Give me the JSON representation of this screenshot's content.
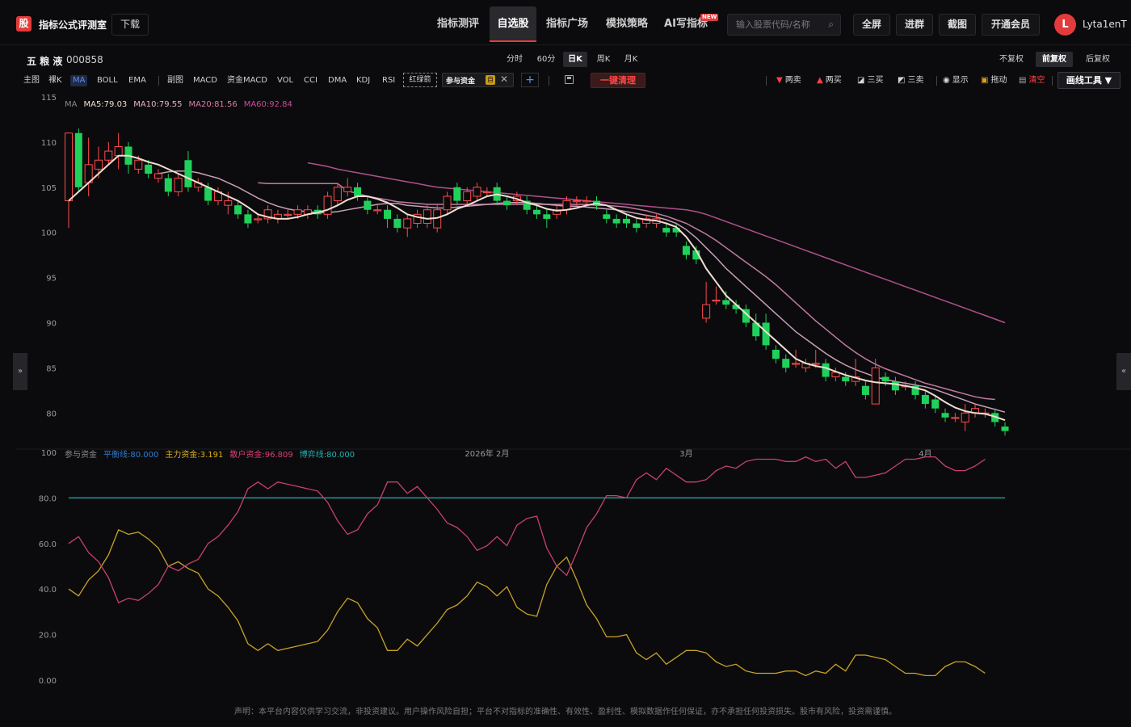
{
  "topbar": {
    "logo_glyph": "股",
    "brand": "指标公式评测室",
    "download": "下载",
    "nav": [
      "指标测评",
      "自选股",
      "指标广场",
      "模拟策略",
      "AI写指标"
    ],
    "active_nav": 1,
    "new_badge": "NEW",
    "search_placeholder": "输入股票代码/名称",
    "buttons": [
      "全屏",
      "进群",
      "截图",
      "开通会员"
    ],
    "avatar_letter": "L",
    "username": "Lyta1enT"
  },
  "stock": {
    "name": "五 粮 液",
    "code": "000858"
  },
  "periods": [
    "分时",
    "60分",
    "日K",
    "周K",
    "月K"
  ],
  "active_period": 2,
  "adjusts": [
    "不复权",
    "前复权",
    "后复权"
  ],
  "active_adjust": 1,
  "indicators_main": [
    "主图",
    "裸K",
    "MA",
    "BOLL",
    "EMA"
  ],
  "indicators_sub": [
    "副图",
    "MACD",
    "资金MACD",
    "VOL",
    "CCI",
    "DMA",
    "KDJ",
    "RSI"
  ],
  "hongluejian": "红绿箭",
  "cyzj_tag": {
    "label": "参与资金",
    "self": "自"
  },
  "clear_button": "一键清理",
  "draw_items": [
    {
      "glyph": "▼",
      "color": "#ff4040",
      "label": "两卖"
    },
    {
      "glyph": "▲",
      "color": "#ff4040",
      "label": "两买"
    },
    {
      "glyph": "◪",
      "color": "#dddddd",
      "label": "三买"
    },
    {
      "glyph": "◩",
      "color": "#dddddd",
      "label": "三卖"
    },
    {
      "glyph": "◉",
      "color": "#dddddd",
      "label": "显示"
    },
    {
      "glyph": "🔒",
      "color": "#e0a020",
      "label": "拖动"
    },
    {
      "glyph": "🗑",
      "color": "#aaaaaa",
      "label": "清空",
      "label_color": "#ff4040"
    }
  ],
  "draw_tools": "画线工具 ▼",
  "disclaimer": "声明：本平台内容仅供学习交流，非投资建议。用户操作风险自担；平台不对指标的准确性、有效性、盈利性、模拟数据作任何保证，亦不承担任何投资损失。股市有风险，投资需谨慎。",
  "colors": {
    "up": "#ff4b4b",
    "down": "#1fd15a",
    "ma5": "#f0ddd0",
    "ma10": "#c7a0b6",
    "ma20": "#c17aa0",
    "ma60": "#b0508e",
    "balance": "#1fb3b3",
    "main": "#c9a227",
    "retail": "#c8416a"
  },
  "chart_data": {
    "type": "candlestick",
    "ma_legend": {
      "title": "MA",
      "items": [
        "MA5:79.03",
        "MA10:79.55",
        "MA20:81.56",
        "MA60:92.84"
      ]
    },
    "price_ylim": [
      76,
      115
    ],
    "price_ticks": [
      80,
      85,
      90,
      95,
      100,
      105,
      110,
      115
    ],
    "x_labels": [
      {
        "i": 42,
        "label": "2026年  2月"
      },
      {
        "i": 62,
        "label": "3月"
      },
      {
        "i": 86,
        "label": "4月"
      }
    ],
    "candles": [
      {
        "o": 103.5,
        "c": 111,
        "h": 111,
        "l": 100.5
      },
      {
        "o": 111,
        "c": 105,
        "h": 111.5,
        "l": 104.5
      },
      {
        "o": 105.5,
        "c": 107.5,
        "h": 110.5,
        "l": 104
      },
      {
        "o": 107,
        "c": 108,
        "h": 109.5,
        "l": 106
      },
      {
        "o": 108,
        "c": 109,
        "h": 110,
        "l": 107.5
      },
      {
        "o": 108.5,
        "c": 109.5,
        "h": 111,
        "l": 107
      },
      {
        "o": 109.5,
        "c": 107.5,
        "h": 110,
        "l": 106.5
      },
      {
        "o": 107,
        "c": 108,
        "h": 108.5,
        "l": 106.5
      },
      {
        "o": 107.5,
        "c": 106.5,
        "h": 108,
        "l": 106
      },
      {
        "o": 106,
        "c": 106.5,
        "h": 107,
        "l": 105.5
      },
      {
        "o": 106,
        "c": 104.5,
        "h": 106.5,
        "l": 104
      },
      {
        "o": 104.5,
        "c": 106,
        "h": 106.5,
        "l": 104
      },
      {
        "o": 108,
        "c": 105,
        "h": 109,
        "l": 104.5
      },
      {
        "o": 105,
        "c": 105.5,
        "h": 106,
        "l": 104.5
      },
      {
        "o": 105,
        "c": 103.5,
        "h": 105.5,
        "l": 103
      },
      {
        "o": 103.5,
        "c": 104.5,
        "h": 105,
        "l": 103
      },
      {
        "o": 103,
        "c": 103.5,
        "h": 104.5,
        "l": 102
      },
      {
        "o": 103,
        "c": 102,
        "h": 103.5,
        "l": 101.5
      },
      {
        "o": 102,
        "c": 101,
        "h": 102.5,
        "l": 100.5
      },
      {
        "o": 101.5,
        "c": 101.5,
        "h": 102,
        "l": 101
      },
      {
        "o": 101.5,
        "c": 102.5,
        "h": 103,
        "l": 101
      },
      {
        "o": 101.5,
        "c": 102,
        "h": 102.5,
        "l": 101
      },
      {
        "o": 102,
        "c": 102,
        "h": 102.5,
        "l": 101.5
      },
      {
        "o": 102,
        "c": 102.5,
        "h": 103,
        "l": 101.5
      },
      {
        "o": 102,
        "c": 102.5,
        "h": 103,
        "l": 101.5
      },
      {
        "o": 102.5,
        "c": 102,
        "h": 103,
        "l": 101.5
      },
      {
        "o": 102,
        "c": 104,
        "h": 104.5,
        "l": 101.5
      },
      {
        "o": 103.5,
        "c": 105,
        "h": 105.5,
        "l": 103
      },
      {
        "o": 104.5,
        "c": 105,
        "h": 106,
        "l": 104
      },
      {
        "o": 105,
        "c": 104,
        "h": 105.5,
        "l": 103.5
      },
      {
        "o": 103.5,
        "c": 102.5,
        "h": 104,
        "l": 102
      },
      {
        "o": 102.5,
        "c": 102.5,
        "h": 103,
        "l": 102
      },
      {
        "o": 102.5,
        "c": 101.5,
        "h": 103,
        "l": 100.5
      },
      {
        "o": 101.5,
        "c": 100.5,
        "h": 102,
        "l": 100
      },
      {
        "o": 100.5,
        "c": 101.5,
        "h": 102,
        "l": 99.5
      },
      {
        "o": 101,
        "c": 102,
        "h": 102.5,
        "l": 100.5
      },
      {
        "o": 101,
        "c": 102.5,
        "h": 103,
        "l": 100.5
      },
      {
        "o": 100.5,
        "c": 102.5,
        "h": 103,
        "l": 100
      },
      {
        "o": 102.5,
        "c": 104,
        "h": 104.5,
        "l": 102
      },
      {
        "o": 105,
        "c": 103.5,
        "h": 105.5,
        "l": 103
      },
      {
        "o": 103.5,
        "c": 104.5,
        "h": 105,
        "l": 103
      },
      {
        "o": 104,
        "c": 105,
        "h": 105.5,
        "l": 103.5
      },
      {
        "o": 104.5,
        "c": 104.5,
        "h": 105,
        "l": 104
      },
      {
        "o": 105,
        "c": 103.5,
        "h": 105.5,
        "l": 103
      },
      {
        "o": 103.5,
        "c": 103,
        "h": 104,
        "l": 102.5
      },
      {
        "o": 103.5,
        "c": 104,
        "h": 104.5,
        "l": 103
      },
      {
        "o": 103.5,
        "c": 102.5,
        "h": 104,
        "l": 102
      },
      {
        "o": 102.5,
        "c": 102,
        "h": 103,
        "l": 101.5
      },
      {
        "o": 102,
        "c": 101.5,
        "h": 102.5,
        "l": 100.5
      },
      {
        "o": 102,
        "c": 102.5,
        "h": 103,
        "l": 101.5
      },
      {
        "o": 102.5,
        "c": 103.5,
        "h": 104,
        "l": 102
      },
      {
        "o": 103.5,
        "c": 103.5,
        "h": 104,
        "l": 103
      },
      {
        "o": 103.5,
        "c": 103.5,
        "h": 104,
        "l": 103
      },
      {
        "o": 103.5,
        "c": 103,
        "h": 104,
        "l": 102.5
      },
      {
        "o": 102,
        "c": 101.5,
        "h": 102.5,
        "l": 101
      },
      {
        "o": 101.5,
        "c": 101,
        "h": 102,
        "l": 100.5
      },
      {
        "o": 101.5,
        "c": 101,
        "h": 102,
        "l": 100.5
      },
      {
        "o": 101,
        "c": 100.5,
        "h": 101.5,
        "l": 100
      },
      {
        "o": 101,
        "c": 101.5,
        "h": 102,
        "l": 100.5
      },
      {
        "o": 101,
        "c": 101.5,
        "h": 102,
        "l": 100.5
      },
      {
        "o": 100.5,
        "c": 100,
        "h": 101,
        "l": 99.5
      },
      {
        "o": 100.5,
        "c": 100,
        "h": 101,
        "l": 99.5
      },
      {
        "o": 98.5,
        "c": 97.5,
        "h": 99,
        "l": 97
      },
      {
        "o": 98,
        "c": 97,
        "h": 98.5,
        "l": 96.5
      },
      {
        "o": 90.5,
        "c": 92,
        "h": 94.5,
        "l": 90
      },
      {
        "o": 92.5,
        "c": 92.5,
        "h": 94,
        "l": 92
      },
      {
        "o": 92.5,
        "c": 92,
        "h": 93.5,
        "l": 91.5
      },
      {
        "o": 92,
        "c": 91.5,
        "h": 92.5,
        "l": 91
      },
      {
        "o": 91.5,
        "c": 90,
        "h": 92,
        "l": 89.5
      },
      {
        "o": 90,
        "c": 88.5,
        "h": 91,
        "l": 88
      },
      {
        "o": 90,
        "c": 87.5,
        "h": 91,
        "l": 87
      },
      {
        "o": 87,
        "c": 86,
        "h": 87.5,
        "l": 85.5
      },
      {
        "o": 86,
        "c": 85,
        "h": 86.5,
        "l": 84.5
      },
      {
        "o": 85.5,
        "c": 85.5,
        "h": 87,
        "l": 85
      },
      {
        "o": 85,
        "c": 85.5,
        "h": 86,
        "l": 84.5
      },
      {
        "o": 85.5,
        "c": 85.5,
        "h": 87,
        "l": 85
      },
      {
        "o": 85.5,
        "c": 84,
        "h": 86,
        "l": 83.5
      },
      {
        "o": 84,
        "c": 84.5,
        "h": 85,
        "l": 83.5
      },
      {
        "o": 84,
        "c": 83.5,
        "h": 84.5,
        "l": 83
      },
      {
        "o": 83.5,
        "c": 84,
        "h": 86,
        "l": 83
      },
      {
        "o": 83,
        "c": 82,
        "h": 83.5,
        "l": 81.5
      },
      {
        "o": 81,
        "c": 85,
        "h": 86,
        "l": 81
      },
      {
        "o": 84,
        "c": 83.5,
        "h": 84.5,
        "l": 83
      },
      {
        "o": 83.5,
        "c": 82.5,
        "h": 84,
        "l": 82
      },
      {
        "o": 83,
        "c": 83,
        "h": 83.5,
        "l": 82.5
      },
      {
        "o": 83,
        "c": 82,
        "h": 83.5,
        "l": 81.5
      },
      {
        "o": 82,
        "c": 81,
        "h": 82.5,
        "l": 80.5
      },
      {
        "o": 81.5,
        "c": 80.5,
        "h": 82,
        "l": 80
      },
      {
        "o": 80,
        "c": 79.5,
        "h": 80.5,
        "l": 79
      },
      {
        "o": 79.5,
        "c": 79.5,
        "h": 80,
        "l": 79
      },
      {
        "o": 79,
        "c": 80,
        "h": 81,
        "l": 78
      },
      {
        "o": 80,
        "c": 80.5,
        "h": 81,
        "l": 79.5
      },
      {
        "o": 80,
        "c": 80,
        "h": 80.5,
        "l": 79.5
      },
      {
        "o": 80,
        "c": 79,
        "h": 80.5,
        "l": 78.5
      },
      {
        "o": 78.5,
        "c": 78,
        "h": 79,
        "l": 77.5
      }
    ],
    "ma5": [
      103.5,
      104.5,
      105.5,
      106.5,
      107.5,
      108.5,
      108.5,
      108.2,
      107.8,
      107.5,
      107,
      106.5,
      106,
      105.5,
      105,
      104.5,
      104,
      103.5,
      102.8,
      102,
      101.7,
      101.5,
      101.5,
      101.7,
      102,
      102.2,
      102.5,
      103,
      103.6,
      104,
      104,
      103.7,
      103.3,
      102.7,
      102,
      101.7,
      101.5,
      101.6,
      102,
      102.6,
      103,
      103.5,
      104,
      104.2,
      104,
      103.7,
      103.3,
      103,
      102.6,
      102.4,
      102.5,
      102.7,
      103,
      103.2,
      103,
      102.5,
      102,
      101.6,
      101.4,
      101.3,
      101,
      100.6,
      99.5,
      98,
      96,
      94.5,
      93,
      92,
      91,
      90,
      89,
      88,
      87,
      86,
      85.5,
      85.2,
      85,
      84.6,
      84.2,
      83.9,
      83.6,
      83.4,
      83.3,
      83.2,
      83,
      82.8,
      82.5,
      81.9,
      81.2,
      80.6,
      80.2,
      80,
      79.9,
      79.6,
      79.2
    ],
    "ma10": [
      null,
      null,
      null,
      null,
      null,
      null,
      null,
      null,
      null,
      106.5,
      106.7,
      106.8,
      106.8,
      106.6,
      106.3,
      106,
      105.5,
      105,
      104.4,
      103.8,
      103.3,
      102.9,
      102.6,
      102.4,
      102.3,
      102.2,
      102.2,
      102.3,
      102.5,
      102.7,
      102.9,
      103.1,
      103.2,
      103.2,
      103,
      102.9,
      102.8,
      102.7,
      102.7,
      102.8,
      102.9,
      103,
      103.1,
      103.2,
      103.3,
      103.3,
      103.3,
      103.2,
      103.1,
      103,
      102.9,
      102.9,
      102.8,
      102.7,
      102.6,
      102.5,
      102.3,
      102.1,
      101.9,
      101.7,
      101.4,
      101,
      100.3,
      99.4,
      98.3,
      97.2,
      96,
      95,
      94,
      93,
      92,
      91,
      90,
      89,
      88.2,
      87.4,
      86.6,
      85.9,
      85.3,
      84.8,
      84.4,
      84,
      83.7,
      83.5,
      83.3,
      83.1,
      82.9,
      82.6,
      82.2,
      81.8,
      81.4,
      81,
      80.7,
      80.4,
      80.1
    ],
    "ma20": [
      null,
      null,
      null,
      null,
      null,
      null,
      null,
      null,
      null,
      null,
      null,
      null,
      null,
      null,
      null,
      null,
      null,
      null,
      null,
      105.5,
      105.4,
      105.4,
      105.4,
      105.4,
      105.4,
      105.4,
      105.4,
      105.4,
      104.6,
      104.3,
      104,
      103.8,
      103.6,
      103.4,
      103.3,
      103.2,
      103.1,
      103.1,
      103.1,
      103.1,
      103.1,
      103.1,
      103.1,
      103.1,
      103.1,
      103.1,
      103.1,
      103.1,
      103.1,
      103.1,
      103.1,
      103.1,
      103.1,
      103,
      103,
      102.9,
      102.8,
      102.6,
      102.4,
      102.1,
      101.8,
      101.4,
      101,
      100.4,
      99.8,
      99.1,
      98.3,
      97.5,
      96.7,
      95.9,
      95.1,
      94.2,
      93.2,
      92.2,
      91.2,
      90.2,
      89.3,
      88.4,
      87.5,
      86.7,
      86,
      85.4,
      84.9,
      84.5,
      84.1,
      83.7,
      83.3,
      83,
      82.7,
      82.4,
      82.1,
      81.8,
      81.6,
      81.5
    ],
    "ma60": [
      null,
      null,
      null,
      null,
      null,
      null,
      null,
      null,
      null,
      null,
      null,
      null,
      null,
      null,
      null,
      null,
      null,
      null,
      null,
      null,
      null,
      null,
      null,
      null,
      107.7,
      107.5,
      107.3,
      107,
      106.8,
      106.6,
      106.4,
      106.2,
      106,
      105.8,
      105.6,
      105.4,
      105.2,
      105,
      104.9,
      104.8,
      104.7,
      104.6,
      104.5,
      104.4,
      104.3,
      104.2,
      104.1,
      104,
      103.9,
      103.8,
      103.7,
      103.6,
      103.5,
      103.4,
      103.3,
      103.2,
      103.1,
      103,
      102.9,
      102.8,
      102.7,
      102.6,
      102.5,
      102.3,
      102,
      101.6,
      101.2,
      100.8,
      100.4,
      100,
      99.6,
      99.2,
      98.8,
      98.4,
      98,
      97.6,
      97.2,
      96.8,
      96.4,
      96,
      95.6,
      95.2,
      94.8,
      94.4,
      94,
      93.6,
      93.2,
      92.8,
      92.4,
      92,
      91.6,
      91.2,
      90.8,
      90.4,
      90
    ],
    "sub_legend": [
      {
        "label": "参与资金",
        "color": "#8a8a8a"
      },
      {
        "label": "平衡线:80.000",
        "color": "#2e7bd1"
      },
      {
        "label": "主力资金:3.191",
        "color": "#d8b020"
      },
      {
        "label": "散户资金:96.809",
        "color": "#d84070"
      },
      {
        "label": "博弈线:80.000",
        "color": "#1fb3b3"
      }
    ],
    "sub_ylim": [
      0,
      100
    ],
    "sub_ticks": [
      "0.00",
      "20.0",
      "40.0",
      "60.0",
      "80.0",
      "100"
    ],
    "balance_line": 80,
    "main_fund": [
      40,
      37,
      44,
      48,
      55,
      66,
      64,
      65,
      62,
      58,
      50,
      52,
      49,
      47,
      40,
      37,
      32,
      26,
      16,
      13,
      16,
      13,
      14,
      15,
      16,
      17,
      22,
      30,
      36,
      34,
      27,
      23,
      13,
      13,
      18,
      15,
      20,
      25,
      31,
      33,
      37,
      43,
      41,
      37,
      41,
      32,
      29,
      28,
      42,
      50,
      54,
      44,
      33,
      27,
      19,
      19,
      20,
      12,
      9,
      12,
      7,
      10,
      13,
      13,
      12,
      8,
      6,
      7,
      4,
      3,
      3,
      3,
      4,
      4,
      2,
      4,
      3,
      7,
      4,
      11,
      11,
      10,
      9,
      6,
      3,
      3,
      2,
      2,
      6,
      8,
      8,
      6,
      3
    ],
    "retail_fund": [
      60,
      63,
      56,
      52,
      45,
      34,
      36,
      35,
      38,
      42,
      50,
      48,
      51,
      53,
      60,
      63,
      68,
      74,
      84,
      87,
      84,
      87,
      86,
      85,
      84,
      83,
      78,
      70,
      64,
      66,
      73,
      77,
      87,
      87,
      82,
      85,
      80,
      75,
      69,
      67,
      63,
      57,
      59,
      63,
      59,
      68,
      71,
      72,
      58,
      50,
      46,
      56,
      67,
      73,
      81,
      81,
      80,
      88,
      91,
      88,
      93,
      90,
      87,
      87,
      88,
      92,
      94,
      93,
      96,
      97,
      97,
      97,
      96,
      96,
      98,
      96,
      97,
      93,
      96,
      89,
      89,
      90,
      91,
      94,
      97,
      97,
      98,
      98,
      94,
      92,
      92,
      94,
      97
    ]
  }
}
